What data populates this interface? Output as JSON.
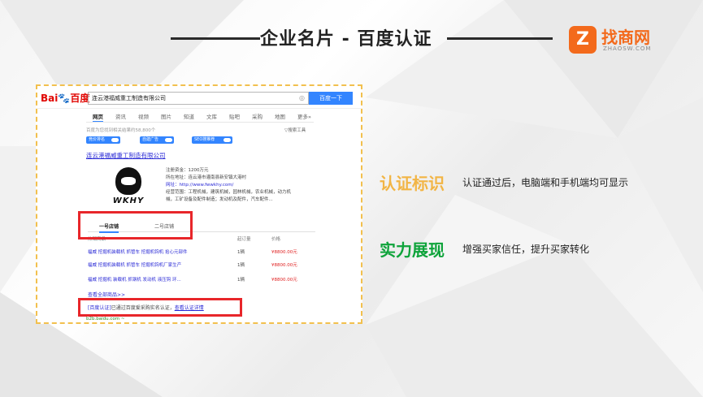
{
  "slide": {
    "title": "企业名片 - 百度认证"
  },
  "brand": {
    "badge": "Z",
    "name": "找商网",
    "sub": "ZHAOSW.COM",
    "color": "#f36a1c"
  },
  "baidu": {
    "logo_a": "Bai",
    "logo_b": "百度",
    "search_value": "连云港福威重工制造有限公司",
    "camera_icon": "camera-icon",
    "search_button": "百度一下",
    "tabs": [
      "网页",
      "资讯",
      "视频",
      "图片",
      "知道",
      "文库",
      "贴吧",
      "采购",
      "地图",
      "更多»"
    ],
    "result_count": "百度为您找到相关结果约58,800个",
    "tools": "▽搜索工具",
    "toggles": [
      "竞价排名",
      "自建广告",
      "SEO搜推荐"
    ],
    "result_title": "连云港福威重工制造有限公司",
    "company_logo": "WKHY",
    "info": [
      "注册资金：1200万元",
      "所在地址：连云港市灌南县新安镇大港村",
      "网址：http://www.fwwkhy.com/",
      "经营范围：工程机械，建筑机械，园林机械，农业机械，动力机",
      "械，工矿设备及配件制造；发动机及配件，汽车配件..."
    ],
    "shop_tabs": [
      "一号店铺",
      "二号店铺"
    ],
    "shop_headers": [
      "热销商品",
      "起订量",
      "价格"
    ],
    "products": [
      {
        "name": "福威 挖掘机装载机 抓管车 挖掘机钩机 拾心元部件",
        "unit": "1辆",
        "price": "¥8800.00元"
      },
      {
        "name": "福威 挖掘机装载机 抓管车 挖掘机钩机厂家生产",
        "unit": "1辆",
        "price": "¥8800.00元"
      },
      {
        "name": "福威 挖掘机 装载机 抓钢机 发动机 液压钩 环...",
        "unit": "1辆",
        "price": "¥8800.00元"
      }
    ],
    "more_link": "查看全部商品>>",
    "verify_tag": "[百度认证]",
    "verify_text": "已通过百度爱采购实名认证，",
    "verify_link": "查看认证详情",
    "url": "b2b.baidu.com ~"
  },
  "features": [
    {
      "heading": "认证标识",
      "desc": "认证通过后，电脑端和手机端均可显示",
      "color": "#f2b545"
    },
    {
      "heading": "实力展现",
      "desc": "增强买家信任，提升买家转化",
      "color": "#0ea33a"
    }
  ],
  "accents": {
    "highlight": "#e8262a",
    "frame": "#f2c04e",
    "baidu_blue": "#3385ff"
  }
}
